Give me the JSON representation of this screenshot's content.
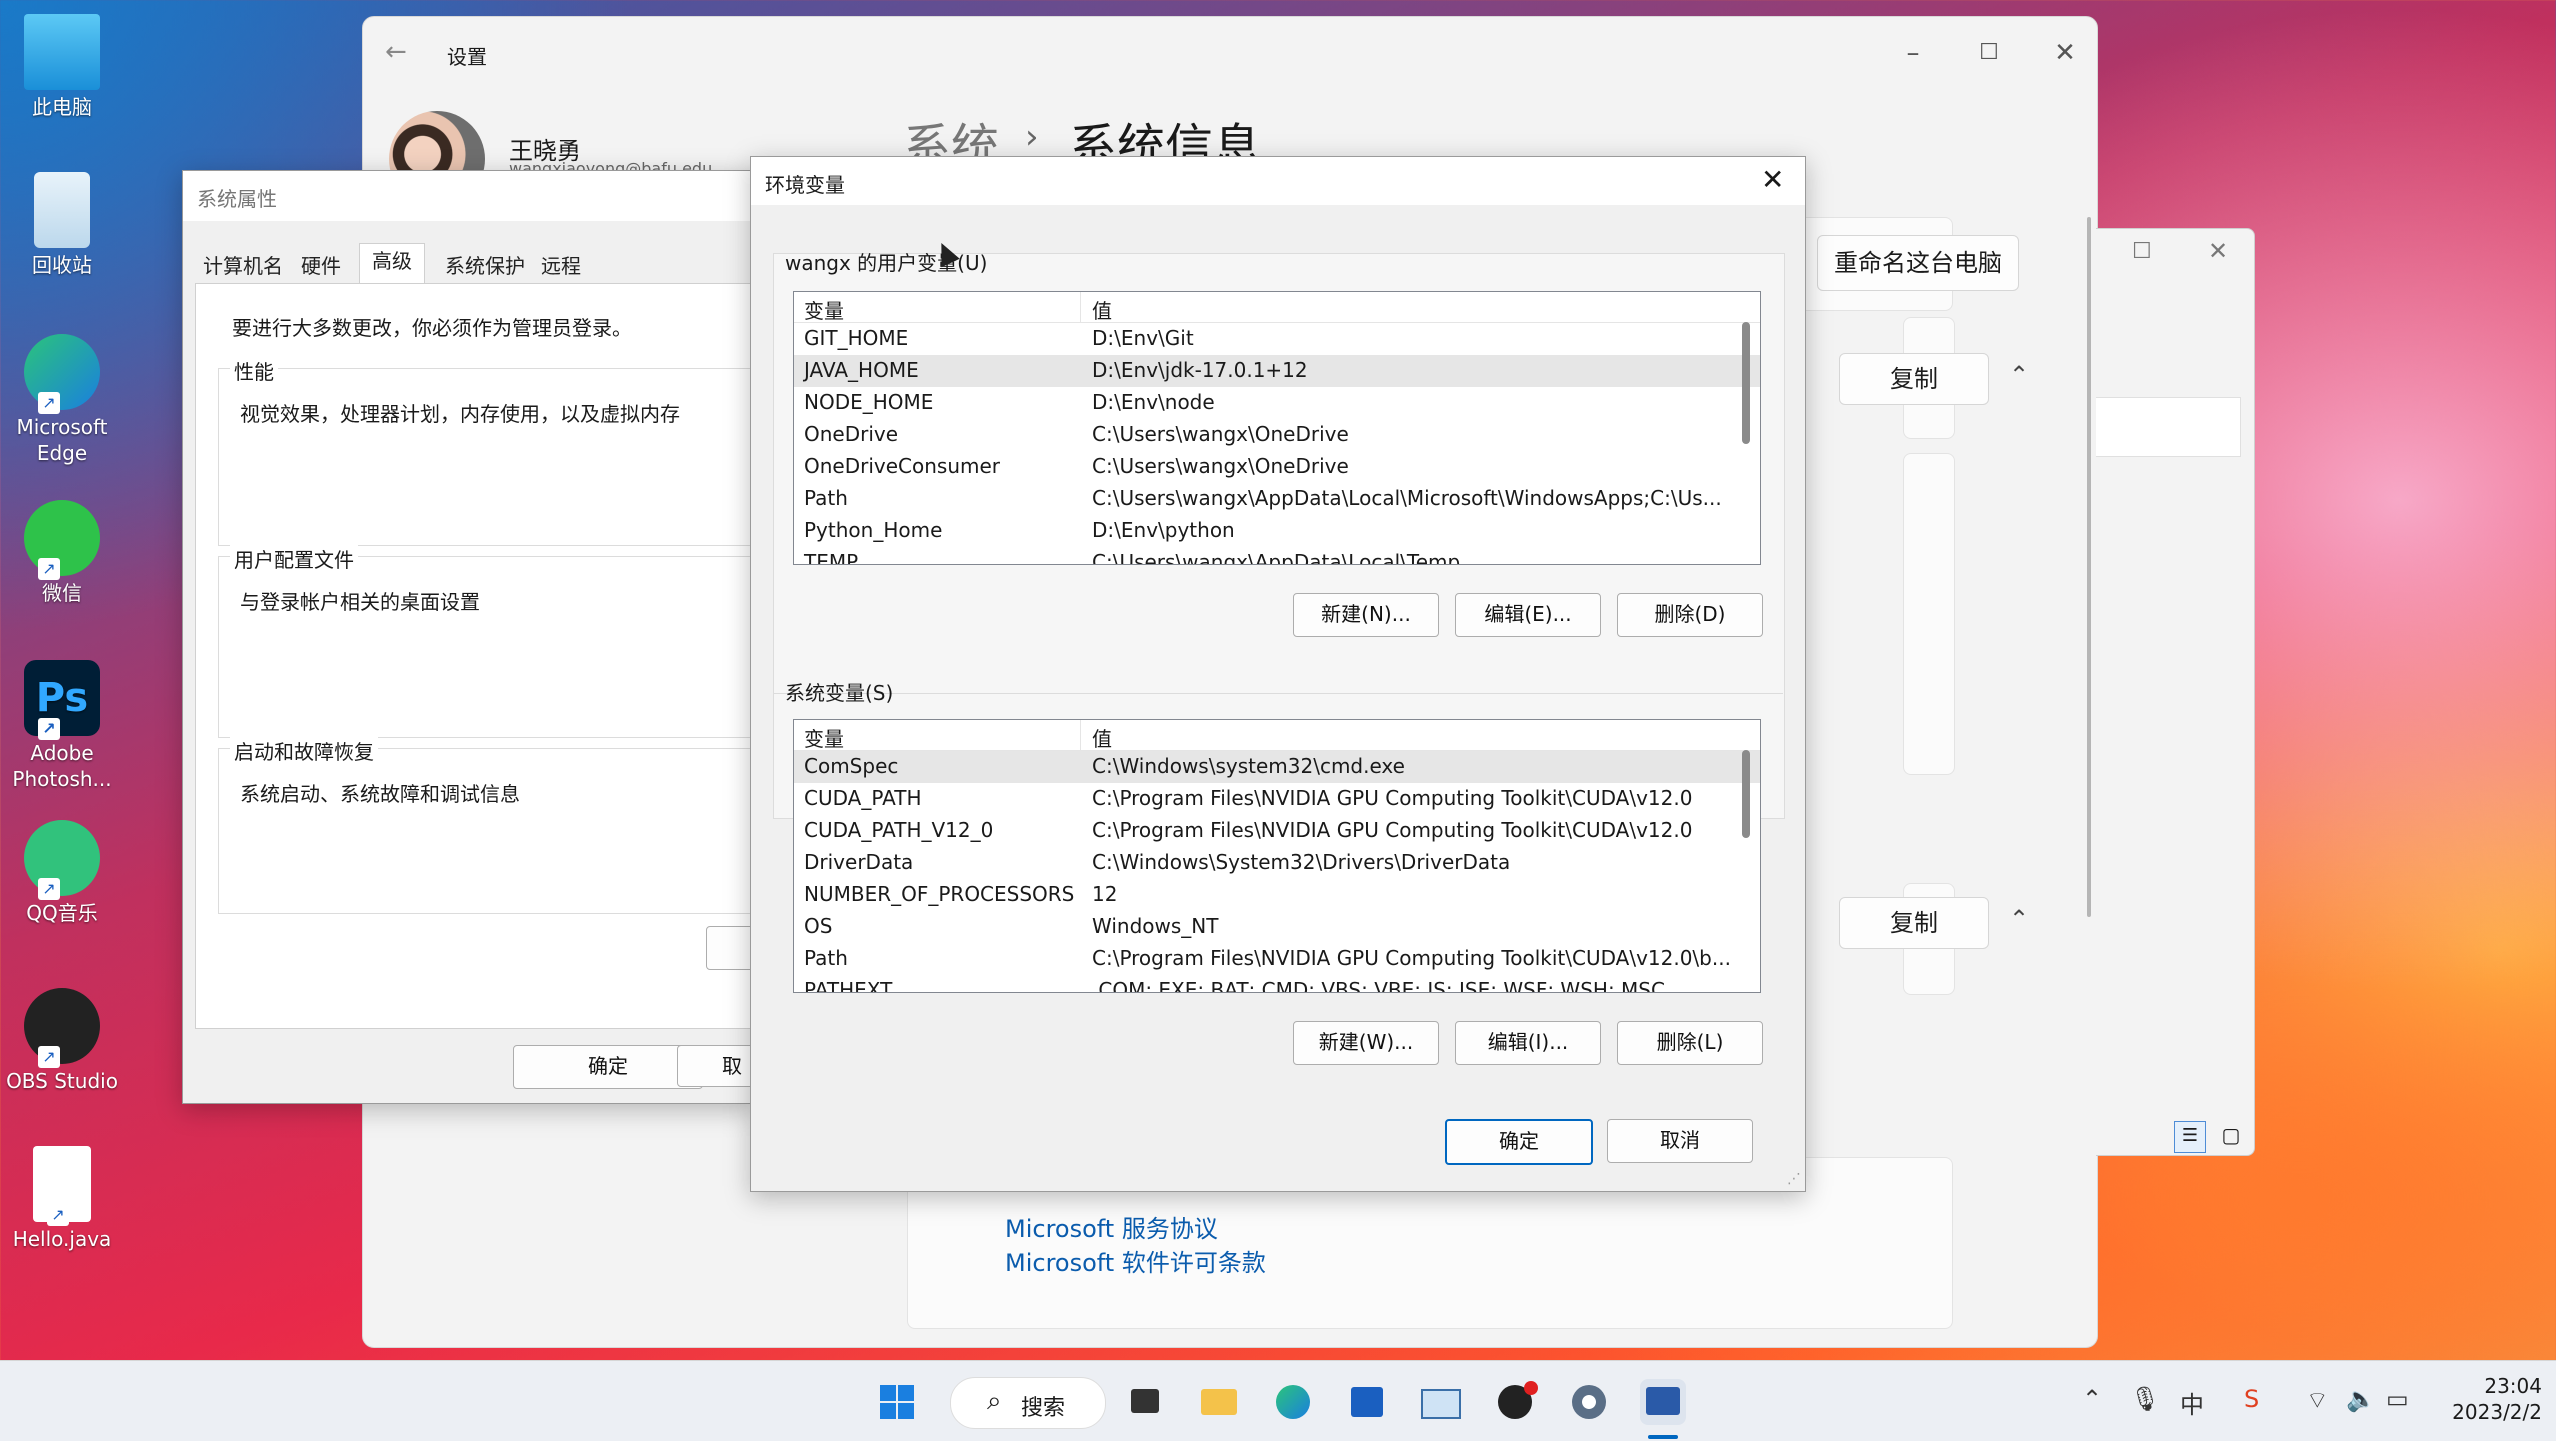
{
  "desktop": {
    "icons": [
      {
        "label": "此电脑",
        "icon": "computer-icon"
      },
      {
        "label": "回收站",
        "icon": "recycle-bin-icon"
      },
      {
        "label": "Microsoft Edge",
        "icon": "edge-icon"
      },
      {
        "label": "微信",
        "icon": "wechat-icon"
      },
      {
        "label": "Adobe Photosh...",
        "icon": "photoshop-icon",
        "glyph": "Ps"
      },
      {
        "label": "QQ音乐",
        "icon": "qq-music-icon"
      },
      {
        "label": "OBS Studio",
        "icon": "obs-icon"
      },
      {
        "label": "Hello.java",
        "icon": "java-file-icon"
      }
    ]
  },
  "settings": {
    "title": "设置",
    "user_name": "王晓勇",
    "user_email_partial": "wangxiaoyong@bafu.edu...",
    "breadcrumb_parent": "系统",
    "breadcrumb_sep": "›",
    "breadcrumb_current": "系统信息",
    "rename_button": "重命名这台电脑",
    "copy_button_1": "复制",
    "copy_button_2": "复制",
    "link_service": "Microsoft 服务协议",
    "link_license": "Microsoft 软件许可条款"
  },
  "sysprops": {
    "title": "系统属性",
    "tabs": [
      "计算机名",
      "硬件",
      "高级",
      "系统保护",
      "远程"
    ],
    "active_tab": "高级",
    "admin_note": "要进行大多数更改，你必须作为管理员登录。",
    "perf_title": "性能",
    "perf_desc": "视觉效果，处理器计划，内存使用，以及虚拟内存",
    "profile_title": "用户配置文件",
    "profile_desc": "与登录帐户相关的桌面设置",
    "startup_title": "启动和故障恢复",
    "startup_desc": "系统启动、系统故障和调试信息",
    "ok": "确定",
    "cancel_partial": "取"
  },
  "envdlg": {
    "title": "环境变量",
    "close": "✕",
    "user_group_label": "wangx 的用户变量(U)",
    "system_group_label": "系统变量(S)",
    "col_var": "变量",
    "col_val": "值",
    "user_vars": [
      {
        "name": "GIT_HOME",
        "value": "D:\\Env\\Git"
      },
      {
        "name": "JAVA_HOME",
        "value": "D:\\Env\\jdk-17.0.1+12"
      },
      {
        "name": "NODE_HOME",
        "value": "D:\\Env\\node"
      },
      {
        "name": "OneDrive",
        "value": "C:\\Users\\wangx\\OneDrive"
      },
      {
        "name": "OneDriveConsumer",
        "value": "C:\\Users\\wangx\\OneDrive"
      },
      {
        "name": "Path",
        "value": "C:\\Users\\wangx\\AppData\\Local\\Microsoft\\WindowsApps;C:\\Us..."
      },
      {
        "name": "Python_Home",
        "value": "D:\\Env\\python"
      },
      {
        "name": "TEMP",
        "value": "C:\\Users\\wangx\\AppData\\Local\\Temp"
      }
    ],
    "user_selected": "JAVA_HOME",
    "system_vars": [
      {
        "name": "ComSpec",
        "value": "C:\\Windows\\system32\\cmd.exe"
      },
      {
        "name": "CUDA_PATH",
        "value": "C:\\Program Files\\NVIDIA GPU Computing Toolkit\\CUDA\\v12.0"
      },
      {
        "name": "CUDA_PATH_V12_0",
        "value": "C:\\Program Files\\NVIDIA GPU Computing Toolkit\\CUDA\\v12.0"
      },
      {
        "name": "DriverData",
        "value": "C:\\Windows\\System32\\Drivers\\DriverData"
      },
      {
        "name": "NUMBER_OF_PROCESSORS",
        "value": "12"
      },
      {
        "name": "OS",
        "value": "Windows_NT"
      },
      {
        "name": "Path",
        "value": "C:\\Program Files\\NVIDIA GPU Computing Toolkit\\CUDA\\v12.0\\b..."
      },
      {
        "name": "PATHEXT",
        "value": ".COM;.EXE;.BAT;.CMD;.VBS;.VBE;.JS;.JSE;.WSF;.WSH;.MSC"
      }
    ],
    "system_selected": "ComSpec",
    "user_new": "新建(N)...",
    "user_edit": "编辑(E)...",
    "user_delete": "删除(D)",
    "sys_new": "新建(W)...",
    "sys_edit": "编辑(I)...",
    "sys_delete": "删除(L)",
    "ok": "确定",
    "cancel": "取消"
  },
  "taskbar": {
    "search_label": "搜索",
    "time": "23:04",
    "date": "2023/2/2"
  }
}
